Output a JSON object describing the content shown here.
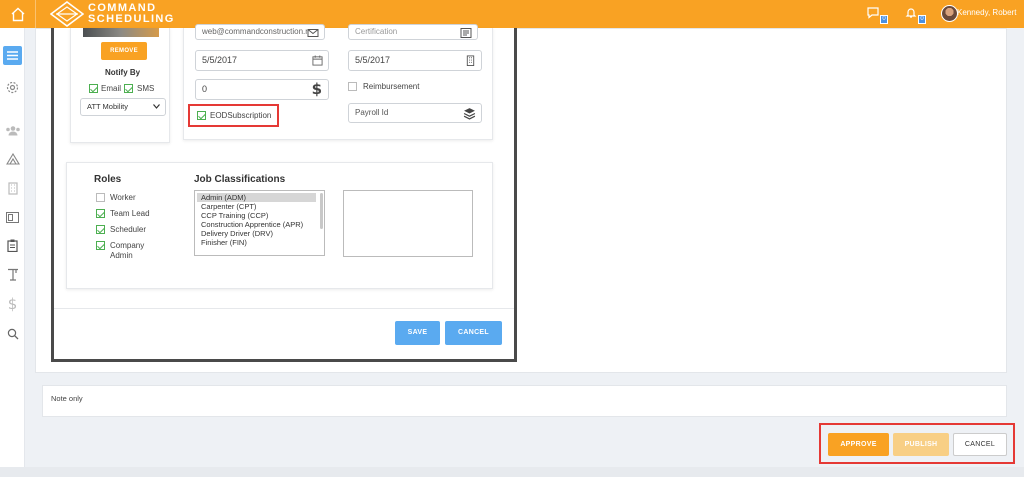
{
  "topbar": {
    "logo_line1": "COMMAND",
    "logo_line2": "SCHEDULING",
    "messages_count": "0",
    "notifications_count": "0",
    "user_name": "Kennedy, Robert",
    "color": "#f9a223"
  },
  "sidebar": {
    "items": [
      "menu-icon",
      "gear-icon",
      "users-icon",
      "sites-icon",
      "building-icon",
      "board-icon",
      "clipboard-icon",
      "crane-icon",
      "dollar-icon",
      "search-icon"
    ]
  },
  "profile": {
    "remove_label": "REMOVE",
    "notify_by_label": "Notify By",
    "email_label": "Email",
    "sms_label": "SMS",
    "carrier_value": "ATT Mobility",
    "email_value": "web@commandconstruction.n",
    "date1": "5/5/2017",
    "date2": "5/5/2017",
    "amount_value": "0",
    "eod_label": "EODSubscription",
    "certification_placeholder": "Certification",
    "reimbursement_label": "Reimbursement",
    "payroll_placeholder": "Payroll Id"
  },
  "roles": {
    "title": "Roles",
    "items": [
      {
        "label": "Worker",
        "checked": false
      },
      {
        "label": "Team Lead",
        "checked": true
      },
      {
        "label": "Scheduler",
        "checked": true
      },
      {
        "label": "Company",
        "label2": "Admin",
        "checked": true
      }
    ]
  },
  "job_classifications": {
    "title": "Job Classifications",
    "options": [
      "Admin (ADM)",
      "Carpenter (CPT)",
      "CCP Training (CCP)",
      "Construction Apprentice (APR)",
      "Delivery Driver (DRV)",
      "Finisher (FIN)"
    ]
  },
  "modal_actions": {
    "save_label": "SAVE",
    "cancel_label": "CANCEL"
  },
  "note": {
    "text": "Note only"
  },
  "footer_actions": {
    "approve_label": "APPROVE",
    "publish_label": "PUBLISH",
    "cancel_label": "CANCEL"
  }
}
